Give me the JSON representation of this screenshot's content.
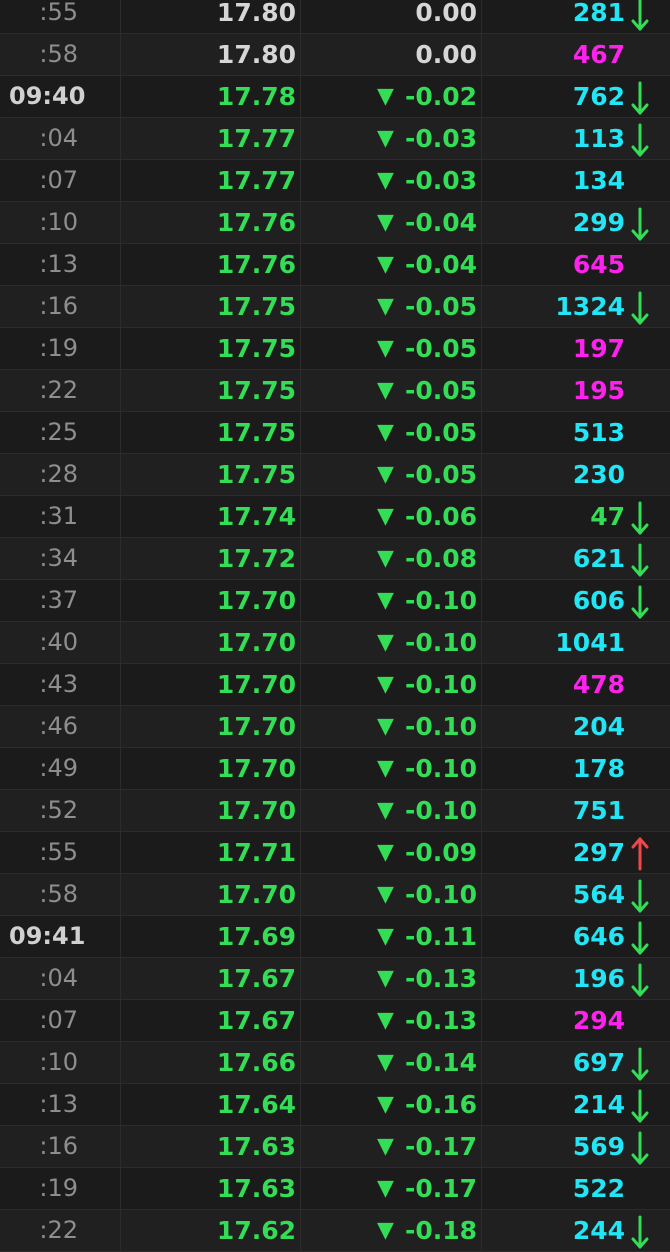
{
  "colors": {
    "down": "#33dd55",
    "flat": "#d6d6d6",
    "vol_buy": "#22e5f5",
    "vol_sell": "#ff22ee",
    "vol_green": "#33dd55",
    "arrow_down": "#33dd55",
    "arrow_up": "#f04848"
  },
  "ticks": [
    {
      "time": ":55",
      "major": false,
      "price": "17.80",
      "change": "0.00",
      "dir": "flat",
      "volume": "281",
      "vol_color": "buy",
      "arrow": "down"
    },
    {
      "time": ":58",
      "major": false,
      "price": "17.80",
      "change": "0.00",
      "dir": "flat",
      "volume": "467",
      "vol_color": "sell",
      "arrow": null
    },
    {
      "time": "09:40",
      "major": true,
      "price": "17.78",
      "change": "-0.02",
      "dir": "down",
      "volume": "762",
      "vol_color": "buy",
      "arrow": "down"
    },
    {
      "time": ":04",
      "major": false,
      "price": "17.77",
      "change": "-0.03",
      "dir": "down",
      "volume": "113",
      "vol_color": "buy",
      "arrow": "down"
    },
    {
      "time": ":07",
      "major": false,
      "price": "17.77",
      "change": "-0.03",
      "dir": "down",
      "volume": "134",
      "vol_color": "buy",
      "arrow": null
    },
    {
      "time": ":10",
      "major": false,
      "price": "17.76",
      "change": "-0.04",
      "dir": "down",
      "volume": "299",
      "vol_color": "buy",
      "arrow": "down"
    },
    {
      "time": ":13",
      "major": false,
      "price": "17.76",
      "change": "-0.04",
      "dir": "down",
      "volume": "645",
      "vol_color": "sell",
      "arrow": null
    },
    {
      "time": ":16",
      "major": false,
      "price": "17.75",
      "change": "-0.05",
      "dir": "down",
      "volume": "1324",
      "vol_color": "buy",
      "arrow": "down"
    },
    {
      "time": ":19",
      "major": false,
      "price": "17.75",
      "change": "-0.05",
      "dir": "down",
      "volume": "197",
      "vol_color": "sell",
      "arrow": null
    },
    {
      "time": ":22",
      "major": false,
      "price": "17.75",
      "change": "-0.05",
      "dir": "down",
      "volume": "195",
      "vol_color": "sell",
      "arrow": null
    },
    {
      "time": ":25",
      "major": false,
      "price": "17.75",
      "change": "-0.05",
      "dir": "down",
      "volume": "513",
      "vol_color": "buy",
      "arrow": null
    },
    {
      "time": ":28",
      "major": false,
      "price": "17.75",
      "change": "-0.05",
      "dir": "down",
      "volume": "230",
      "vol_color": "buy",
      "arrow": null
    },
    {
      "time": ":31",
      "major": false,
      "price": "17.74",
      "change": "-0.06",
      "dir": "down",
      "volume": "47",
      "vol_color": "green",
      "arrow": "down"
    },
    {
      "time": ":34",
      "major": false,
      "price": "17.72",
      "change": "-0.08",
      "dir": "down",
      "volume": "621",
      "vol_color": "buy",
      "arrow": "down"
    },
    {
      "time": ":37",
      "major": false,
      "price": "17.70",
      "change": "-0.10",
      "dir": "down",
      "volume": "606",
      "vol_color": "buy",
      "arrow": "down"
    },
    {
      "time": ":40",
      "major": false,
      "price": "17.70",
      "change": "-0.10",
      "dir": "down",
      "volume": "1041",
      "vol_color": "buy",
      "arrow": null
    },
    {
      "time": ":43",
      "major": false,
      "price": "17.70",
      "change": "-0.10",
      "dir": "down",
      "volume": "478",
      "vol_color": "sell",
      "arrow": null
    },
    {
      "time": ":46",
      "major": false,
      "price": "17.70",
      "change": "-0.10",
      "dir": "down",
      "volume": "204",
      "vol_color": "buy",
      "arrow": null
    },
    {
      "time": ":49",
      "major": false,
      "price": "17.70",
      "change": "-0.10",
      "dir": "down",
      "volume": "178",
      "vol_color": "buy",
      "arrow": null
    },
    {
      "time": ":52",
      "major": false,
      "price": "17.70",
      "change": "-0.10",
      "dir": "down",
      "volume": "751",
      "vol_color": "buy",
      "arrow": null
    },
    {
      "time": ":55",
      "major": false,
      "price": "17.71",
      "change": "-0.09",
      "dir": "down",
      "volume": "297",
      "vol_color": "buy",
      "arrow": "up"
    },
    {
      "time": ":58",
      "major": false,
      "price": "17.70",
      "change": "-0.10",
      "dir": "down",
      "volume": "564",
      "vol_color": "buy",
      "arrow": "down"
    },
    {
      "time": "09:41",
      "major": true,
      "price": "17.69",
      "change": "-0.11",
      "dir": "down",
      "volume": "646",
      "vol_color": "buy",
      "arrow": "down"
    },
    {
      "time": ":04",
      "major": false,
      "price": "17.67",
      "change": "-0.13",
      "dir": "down",
      "volume": "196",
      "vol_color": "buy",
      "arrow": "down"
    },
    {
      "time": ":07",
      "major": false,
      "price": "17.67",
      "change": "-0.13",
      "dir": "down",
      "volume": "294",
      "vol_color": "sell",
      "arrow": null
    },
    {
      "time": ":10",
      "major": false,
      "price": "17.66",
      "change": "-0.14",
      "dir": "down",
      "volume": "697",
      "vol_color": "buy",
      "arrow": "down"
    },
    {
      "time": ":13",
      "major": false,
      "price": "17.64",
      "change": "-0.16",
      "dir": "down",
      "volume": "214",
      "vol_color": "buy",
      "arrow": "down"
    },
    {
      "time": ":16",
      "major": false,
      "price": "17.63",
      "change": "-0.17",
      "dir": "down",
      "volume": "569",
      "vol_color": "buy",
      "arrow": "down"
    },
    {
      "time": ":19",
      "major": false,
      "price": "17.63",
      "change": "-0.17",
      "dir": "down",
      "volume": "522",
      "vol_color": "buy",
      "arrow": null
    },
    {
      "time": ":22",
      "major": false,
      "price": "17.62",
      "change": "-0.18",
      "dir": "down",
      "volume": "244",
      "vol_color": "buy",
      "arrow": "down"
    }
  ]
}
